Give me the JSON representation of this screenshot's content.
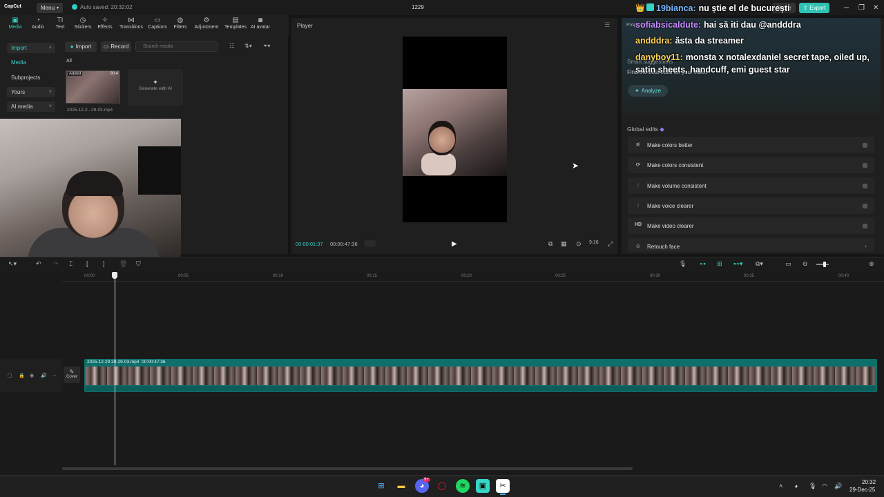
{
  "titlebar": {
    "app_logo": "CapCut",
    "menu_label": "Menu",
    "autosave": "Auto saved: 20:32:02",
    "project_name": "1229",
    "share_label": "Share",
    "export_label": "Export"
  },
  "toolbar": {
    "tools": [
      {
        "label": "Media",
        "icon": "media-icon"
      },
      {
        "label": "Audio",
        "icon": "audio-icon"
      },
      {
        "label": "Text",
        "icon": "text-icon"
      },
      {
        "label": "Stickers",
        "icon": "stickers-icon"
      },
      {
        "label": "Effects",
        "icon": "effects-icon"
      },
      {
        "label": "Transitions",
        "icon": "transitions-icon"
      },
      {
        "label": "Captions",
        "icon": "captions-icon"
      },
      {
        "label": "Filters",
        "icon": "filters-icon"
      },
      {
        "label": "Adjustment",
        "icon": "adjustment-icon"
      },
      {
        "label": "Templates",
        "icon": "templates-icon"
      },
      {
        "label": "AI avatar",
        "icon": "ai-avatar-icon"
      }
    ]
  },
  "media": {
    "sidebar": {
      "import": "Import",
      "media": "Media",
      "subprojects": "Subprojects",
      "yours": "Yours",
      "ai_media": "AI media"
    },
    "import_button": "Import",
    "record_button": "Record",
    "search_placeholder": "Search media",
    "filter_all": "All",
    "thumb_badge": "Added",
    "thumb_duration": "00:4",
    "file_name": "2025-12-2...29-03.mp4",
    "generate_ai": "Generate with AI"
  },
  "player": {
    "title": "Player",
    "current_time": "00:00:01:37",
    "total_time": "00:00:47:36",
    "ratio_label": "9:16"
  },
  "right_panel": {
    "tab_label": "Properties",
    "smart_label": "Smart suggestions",
    "find_label": "Find the best edits for your video",
    "analyze_label": "Analyze",
    "global_edits_label": "Global edits",
    "global_edits": [
      {
        "label": "Make colors better",
        "icon": "magic-wand-icon"
      },
      {
        "label": "Make colors consistent",
        "icon": "color-match-icon"
      },
      {
        "label": "Make volume consistent",
        "icon": "sliders-icon"
      },
      {
        "label": "Make voice clearer",
        "icon": "waveform-icon"
      },
      {
        "label": "Make video clearer",
        "icon": "hd-icon"
      },
      {
        "label": "Retouch face",
        "icon": "face-icon"
      }
    ]
  },
  "chat": [
    {
      "user": "19bianca:",
      "message": "nu știe el de bucurești",
      "color": "#7ab8ff"
    },
    {
      "user": "sofiabsicaldute:",
      "message": "hai să iti dau @andddra",
      "color": "#c48cff"
    },
    {
      "user": "andddra:",
      "message": "ăsta da streamer",
      "color": "#ffd45a"
    },
    {
      "user": "danyboy11:",
      "message": "monsta x notalexdaniel secret tape, oiled up,",
      "color": "#ffd45a"
    },
    {
      "user": "",
      "message": "satin sheets, handcuff, emi guest star",
      "color": "#ffd45a"
    }
  ],
  "timeline": {
    "ruler_ticks": [
      "00:00",
      "00:05",
      "00:10",
      "00:15",
      "00:20",
      "00:25",
      "00:30",
      "00:35",
      "00:40"
    ],
    "clip_name": "2025-12-29 20-29-03.mp4",
    "clip_duration": "00:00:47:36",
    "cover_label": "Cover"
  },
  "taskbar": {
    "time": "20:32",
    "date": "29-Dec-25",
    "discord_badge": "9+"
  },
  "colors": {
    "accent": "#37d1c4",
    "export_button": "#2fc1b3",
    "clip": "#0e6f6b"
  }
}
